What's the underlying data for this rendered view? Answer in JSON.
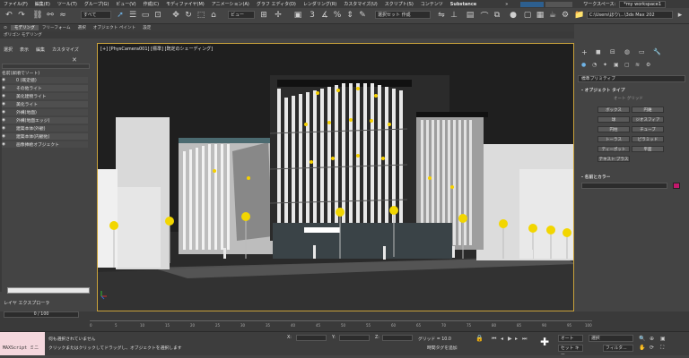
{
  "menu": [
    "ファイル(F)",
    "編集(E)",
    "ツール(T)",
    "グループ(G)",
    "ビュー(V)",
    "作成(C)",
    "モディファイヤ(M)",
    "アニメーション(A)",
    "グラフ エディタ(D)",
    "レンダリング(R)",
    "カスタマイズ(U)",
    "スクリプト(S)",
    "コンテンツ",
    "Substance"
  ],
  "menu_more": "»",
  "workspace_label": "ワークスペース:",
  "workspace_value": "*my workspace1",
  "toolbar": {
    "filter_dropdown": "すべて",
    "view_dropdown": "ビュー",
    "selection_set": "選択セット 作成",
    "path_field": "C:\\Users\\ほり\\...\\3ds Max 202"
  },
  "ribbon_tabs": [
    "モデリング",
    "フリーフォーム",
    "選択",
    "オブジェクト ペイント",
    "設定"
  ],
  "ribbon_sub": "ポリゴン モデリング",
  "scene_explorer": {
    "menu": [
      "選択",
      "表示",
      "編集",
      "カスタマイズ"
    ],
    "sort_header": "名前(昇順でソート)",
    "layers": [
      "0 (既定値)",
      "その他ライト",
      "美化建物ライト",
      "美化ライト",
      "外構(地面)",
      "外構(地面エッジ)",
      "建築本体(外観)",
      "建築本体(内観他)",
      "画像挿絵オブジェクト"
    ]
  },
  "viewport": {
    "label": "[+] [PhysCamera001] [標準] [既定のシェーディング]"
  },
  "command_panel": {
    "category": "標準プリミティブ",
    "object_type_header": "- オブジェクト タイプ",
    "autogrid": "オート グリッド",
    "buttons": [
      "ボックス",
      "円錐",
      "球",
      "ジオスフィア",
      "円柱",
      "チューブ",
      "トーラス",
      "ピラミッド",
      "ティーポット",
      "平面",
      "テキスト プラス"
    ],
    "name_color_header": "- 名前とカラー",
    "name_color_swatch": "#c2186b"
  },
  "layer_explorer_label": "レイヤ エクスプローラ",
  "frame_counter": "0 / 100",
  "timeline_ticks": [
    "0",
    "5",
    "10",
    "15",
    "20",
    "25",
    "30",
    "35",
    "40",
    "45",
    "50",
    "55",
    "60",
    "65",
    "70",
    "75",
    "80",
    "85",
    "90",
    "95",
    "100"
  ],
  "status": {
    "maxscript": "MAXScript ミニ",
    "line1": "何も選択されていません",
    "line2": "クリックまたはクリックしてドラッグし、オブジェクトを選択します",
    "x_label": "X:",
    "y_label": "Y:",
    "z_label": "Z:",
    "grid": "グリッド = 10.0",
    "time_tag": "時間タグを追加",
    "auto_key": "オート",
    "set_key": "セット キー",
    "selected": "選択",
    "filter": "フィルタ..."
  }
}
